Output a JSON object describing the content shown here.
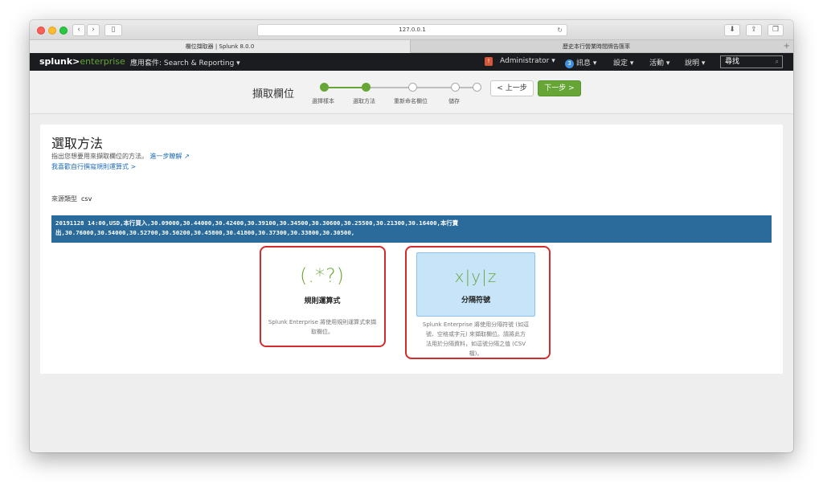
{
  "browser": {
    "address": "127.0.0.1",
    "tabs": [
      {
        "title": "欄位擷取器 | Splunk 8.0.0"
      },
      {
        "title": "歷史本行營業時間牌告匯率"
      }
    ]
  },
  "header": {
    "logo_main": "splunk>",
    "logo_sub": "enterprise",
    "app_menu": "應用套件: Search & Reporting ▾",
    "alert_icon": "!",
    "user": "Administrator ▾",
    "messages_count": "3",
    "messages": "訊息 ▾",
    "settings": "設定 ▾",
    "activity": "活動 ▾",
    "help": "說明 ▾",
    "search_placeholder": "尋找"
  },
  "wizard": {
    "title": "擷取欄位",
    "steps": [
      {
        "label": "選擇樣本",
        "state": "done"
      },
      {
        "label": "選取方法",
        "state": "done"
      },
      {
        "label": "重新命名欄位",
        "state": "todo"
      },
      {
        "label": "儲存",
        "state": "todo"
      }
    ],
    "prev_label": "< 上一步",
    "next_label": "下一步 >"
  },
  "main": {
    "title": "選取方法",
    "desc": "指出您想要用來擷取欄位的方法。",
    "learn_more": "進一步瞭解 ↗",
    "regex_link": "我喜歡自行撰寫規則運算式 >",
    "sourcetype_label": "來源類型",
    "sourcetype_value": "csv",
    "sample_line1": "20191128 14:00,USD,本行買入,30.09000,30.44000,30.42400,30.39100,30.34500,30.30600,30.25500,30.21300,30.16400,本行賣",
    "sample_line2": "出,30.76000,30.54000,30.52700,30.50200,30.45800,30.41800,30.37300,30.33800,30.30500,",
    "methods": [
      {
        "symbol": "(.*?)",
        "name": "規則運算式",
        "desc1": "Splunk Enterprise 將使用規則運算式來擷",
        "desc2": "取欄位。"
      },
      {
        "symbol": "x|y|z",
        "name": "分隔符號",
        "desc1": "Splunk Enterprise 將使用分隔符號 (如逗",
        "desc2": "號、空格或字元) 來擷取欄位。請將此方",
        "desc3": "法用於分隔資料，如逗號分隔之值 (CSV",
        "desc4": "檔)。"
      }
    ]
  },
  "colors": {
    "accent_green": "#65a637",
    "highlight_red": "#d42b2b",
    "sample_bg": "#2a6b9b"
  }
}
